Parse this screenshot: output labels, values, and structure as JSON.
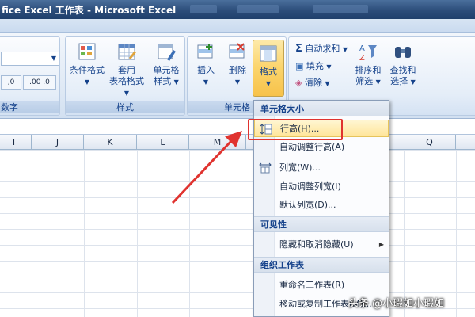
{
  "window": {
    "title": "fice Excel 工作表 - Microsoft Excel"
  },
  "ribbon": {
    "number_group_label": "数字",
    "number_btns": [
      ".0 →.00",
      "→.00 .0"
    ],
    "styles_group": {
      "label": "样式",
      "conditional_format": "条件格式",
      "table_format_1": "套用",
      "table_format_2": "表格格式",
      "cell_styles_1": "单元格",
      "cell_styles_2": "样式"
    },
    "cells_group": {
      "label": "单元格",
      "insert": "插入",
      "delete": "删除",
      "format": "格式"
    },
    "editing_group": {
      "autosum": "自动求和",
      "fill": "填充",
      "clear": "清除",
      "sort_filter_1": "排序和",
      "sort_filter_2": "筛选",
      "find_select_1": "查找和",
      "find_select_2": "选择"
    }
  },
  "columns": [
    "I",
    "J",
    "K",
    "L",
    "M",
    "Q"
  ],
  "menu": {
    "section_cell_size": "单元格大小",
    "row_height": "行高(H)...",
    "autofit_row_height": "自动调整行高(A)",
    "column_width": "列宽(W)...",
    "autofit_column_width": "自动调整列宽(I)",
    "default_width": "默认列宽(D)...",
    "section_visibility": "可见性",
    "hide_unhide": "隐藏和取消隐藏(U)",
    "section_organize": "组织工作表",
    "rename_sheet": "重命名工作表(R)",
    "move_copy_sheet": "移动或复制工作表(M)..."
  },
  "watermark": "头条 @小瑕如小瑕如",
  "colors": {
    "highlight_box": "#e0332f",
    "menu_hover": "#ffe59a",
    "ribbon_text": "#15428b"
  }
}
